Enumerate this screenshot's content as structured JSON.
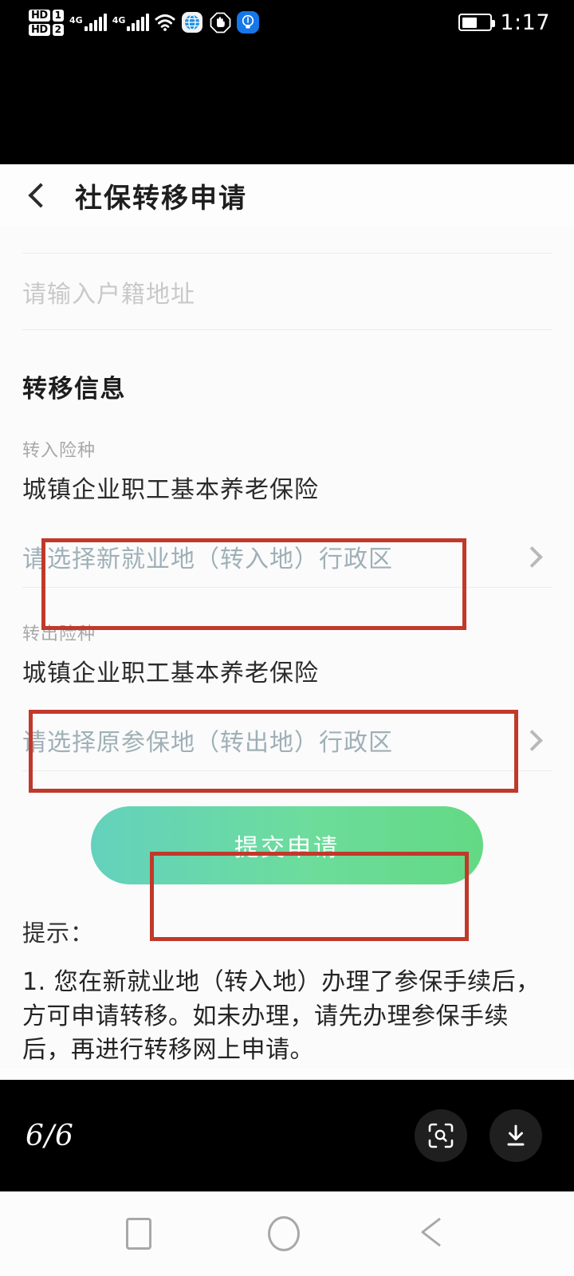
{
  "statusbar": {
    "carrier_hd_1_label": "HD",
    "carrier_hd_1_slot": "1",
    "carrier_hd_2_label": "HD",
    "carrier_hd_2_slot": "2",
    "network_1": "4G",
    "network_2": "4G",
    "icons": [
      "wifi-icon",
      "browser-globe-icon",
      "hand-do-not-disturb-icon",
      "flashlight-icon"
    ],
    "time": "1:17",
    "battery_level_percent": 55
  },
  "app": {
    "nav": {
      "back_icon": "back-chevron-icon",
      "title": "社保转移申请"
    },
    "clipped_top_row_text": " ",
    "household_address": {
      "placeholder": "请输入户籍地址",
      "value": ""
    },
    "transfer_section": {
      "title": "转移信息",
      "transfer_in": {
        "label": "转入险种",
        "value": "城镇企业职工基本养老保险",
        "region_placeholder": "请选择新就业地（转入地）行政区",
        "chevron": "chevron-right-icon"
      },
      "transfer_out": {
        "label": "转出险种",
        "value": "城镇企业职工基本养老保险",
        "region_placeholder": "请选择原参保地（转出地）行政区",
        "chevron": "chevron-right-icon"
      }
    },
    "submit_button_label": "提交申请",
    "tips": {
      "heading": "提示：",
      "item_1": "1. 您在新就业地（转入地）办理了参保手续后，方可申请转移。如未办理，请先办理参保手续后，再进行转移网上申请。"
    }
  },
  "annotations": {
    "box_color": "#c0392b",
    "boxes": [
      "transfer-in-region-row",
      "transfer-out-region-row",
      "submit-button"
    ]
  },
  "gallery": {
    "page_indicator": "6/6",
    "actions": [
      "lens-scan-icon",
      "download-icon"
    ]
  },
  "android_nav": {
    "items": [
      "recents-square-icon",
      "home-circle-icon",
      "back-triangle-icon"
    ]
  },
  "colors": {
    "submit_gradient_start": "#63d2bd",
    "submit_gradient_end": "#63d984",
    "placeholder_select": "#9fb0b7",
    "annotation_red": "#c0392b"
  }
}
